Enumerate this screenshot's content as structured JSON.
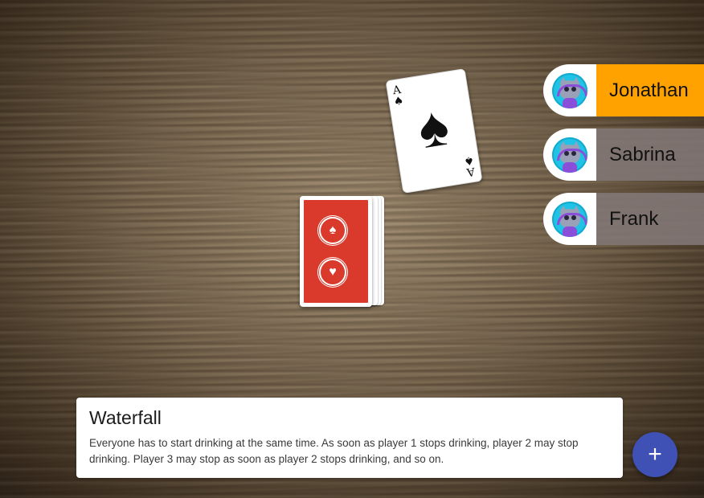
{
  "players": [
    {
      "name": "Jonathan",
      "active": true
    },
    {
      "name": "Sabrina",
      "active": false
    },
    {
      "name": "Frank",
      "active": false
    }
  ],
  "current_card": {
    "rank": "A",
    "suit_symbol": "♠",
    "suit": "spades"
  },
  "rule": {
    "title": "Waterfall",
    "description": "Everyone has to start drinking at the same time. As soon as player 1 stops drinking, player 2 may stop drinking. Player 3 may stop as soon as player 2 stops drinking, and so on."
  },
  "fab": {
    "icon": "plus-icon",
    "label": "+"
  },
  "deck": {
    "back_symbols": [
      "♠",
      "♥"
    ]
  },
  "colors": {
    "active_player": "#ffa200",
    "card_back": "#d93a2b",
    "fab": "#3f51b5",
    "avatar_bg": "#1fc3e6"
  }
}
